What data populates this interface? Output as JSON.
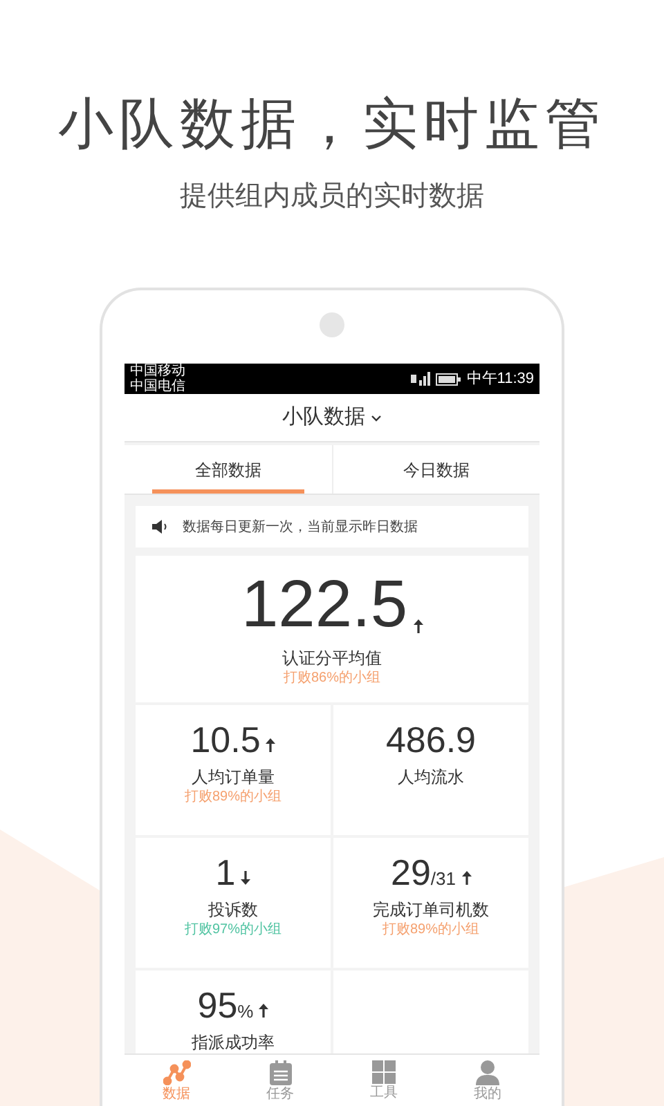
{
  "headline": "小队数据，实时监管",
  "subtitle": "提供组内成员的实时数据",
  "status_bar": {
    "carriers": [
      "中国移动",
      "中国电信"
    ],
    "time": "中午11:39"
  },
  "header": {
    "title": "小队数据"
  },
  "tabs": [
    {
      "label": "全部数据",
      "selected": true
    },
    {
      "label": "今日数据",
      "selected": false
    }
  ],
  "notice": "数据每日更新一次，当前显示昨日数据",
  "hero": {
    "value": "122.5",
    "rising": true,
    "label": "认证分平均值",
    "note": "打败86%的小组",
    "color": "#f5a06e"
  },
  "stats": [
    {
      "value": "10.5",
      "rising": true,
      "label": "人均订单量",
      "note": "打败89%的小组",
      "color": "#f5a06e"
    },
    {
      "value": "486.9",
      "label": "人均流水"
    },
    {
      "value": "1",
      "rising": false,
      "label": "投诉数",
      "note": "打败97%的小组",
      "color": "#4fc3a1"
    },
    {
      "value": "29",
      "unit": "/31",
      "rising": true,
      "label": "完成订单司机数",
      "note": "打败89%的小组",
      "color": "#f5a06e"
    },
    {
      "value": "95",
      "unit": "%",
      "rising": true,
      "label": "指派成功率"
    }
  ],
  "nav": [
    {
      "label": "数据",
      "selected": true
    },
    {
      "label": "任务",
      "selected": false
    },
    {
      "label": "工具",
      "selected": false
    },
    {
      "label": "我的",
      "selected": false
    }
  ]
}
